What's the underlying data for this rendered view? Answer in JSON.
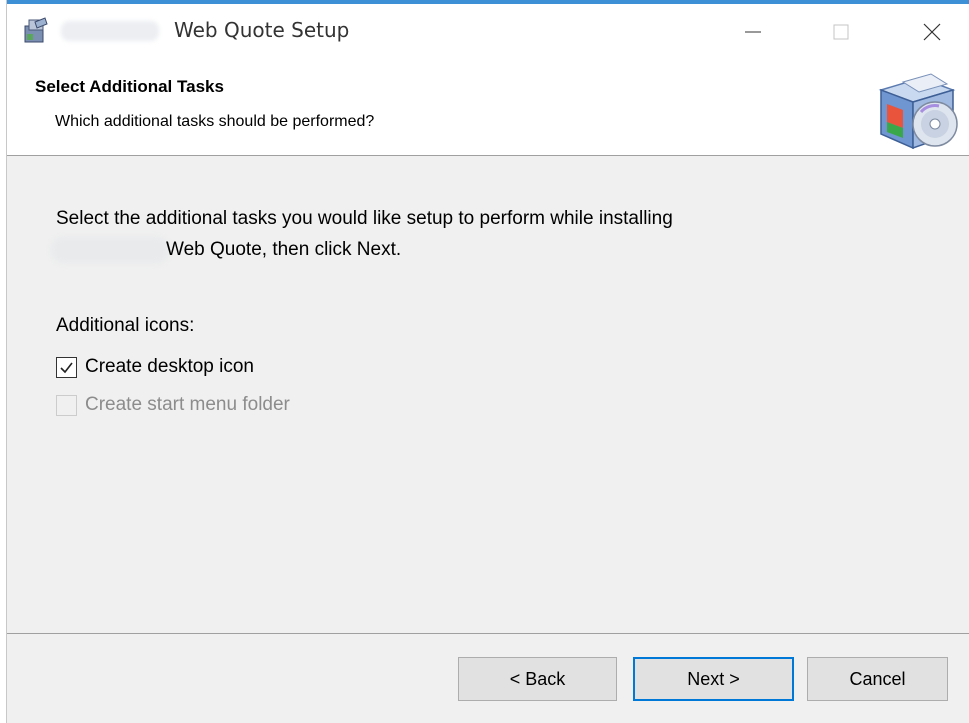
{
  "window": {
    "title": "Web Quote Setup"
  },
  "header": {
    "title": "Select Additional Tasks",
    "subtitle": "Which additional tasks should be performed?"
  },
  "content": {
    "description_line1": "Select the additional tasks you would like setup to perform while installing",
    "description_line2": "Web Quote, then click Next.",
    "group_label": "Additional icons:",
    "options": [
      {
        "label": "Create desktop icon",
        "checked": true,
        "enabled": true
      },
      {
        "label": "Create start menu folder",
        "checked": false,
        "enabled": false
      }
    ]
  },
  "buttons": {
    "back": "< Back",
    "next": "Next >",
    "cancel": "Cancel"
  },
  "colors": {
    "accent": "#0078d7",
    "dialog_bg": "#f0f0f0",
    "button_bg": "#e1e1e1"
  },
  "icons": {
    "app": "setup-installer-icon",
    "header": "setup-box-cd-icon",
    "check": "checkmark-icon"
  }
}
